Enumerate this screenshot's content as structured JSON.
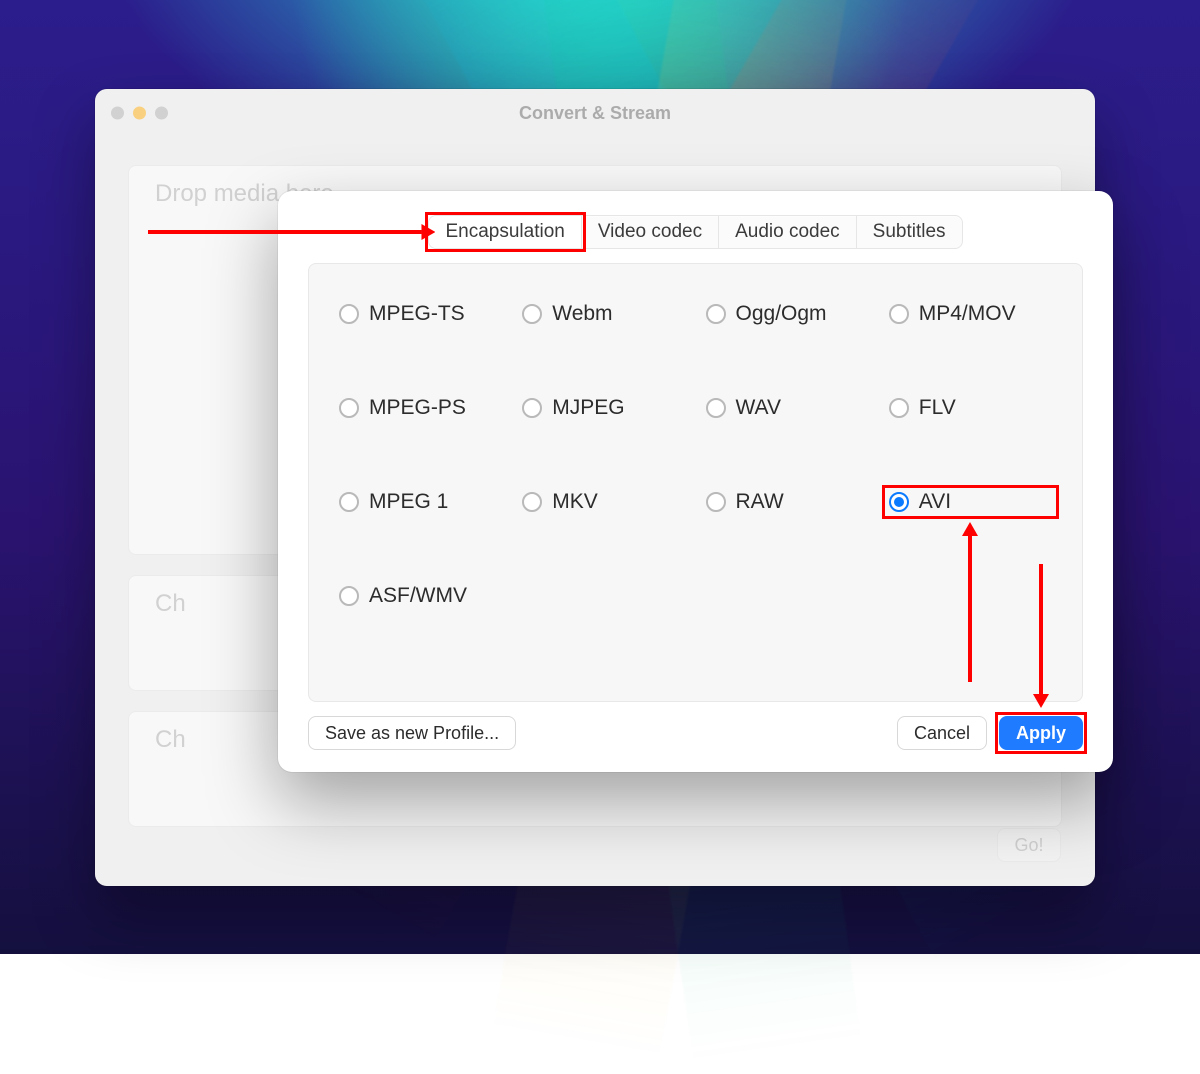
{
  "window": {
    "title": "Convert & Stream",
    "groups": {
      "drop": "Drop media here",
      "profile": "Ch",
      "dest": "Ch"
    },
    "go_label": "Go!"
  },
  "modal": {
    "tabs": [
      "Encapsulation",
      "Video codec",
      "Audio codec",
      "Subtitles"
    ],
    "active_tab": 0,
    "options": [
      "MPEG-TS",
      "Webm",
      "Ogg/Ogm",
      "MP4/MOV",
      "MPEG-PS",
      "MJPEG",
      "WAV",
      "FLV",
      "MPEG 1",
      "MKV",
      "RAW",
      "AVI",
      "ASF/WMV"
    ],
    "selected_option": "AVI",
    "buttons": {
      "save_profile": "Save as new Profile...",
      "cancel": "Cancel",
      "apply": "Apply"
    }
  },
  "annotations": {
    "highlight_tab": 0,
    "highlight_option": "AVI",
    "highlight_button": "apply"
  }
}
